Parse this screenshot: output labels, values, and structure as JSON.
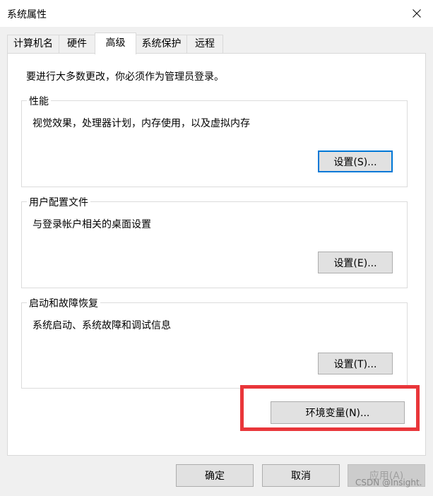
{
  "window": {
    "title": "系统属性"
  },
  "tabs": [
    {
      "label": "计算机名",
      "active": false
    },
    {
      "label": "硬件",
      "active": false
    },
    {
      "label": "高级",
      "active": true
    },
    {
      "label": "系统保护",
      "active": false
    },
    {
      "label": "远程",
      "active": false
    }
  ],
  "admin_notice": "要进行大多数更改，你必须作为管理员登录。",
  "groups": {
    "performance": {
      "title": "性能",
      "description": "视觉效果，处理器计划，内存使用，以及虚拟内存",
      "button": "设置(S)..."
    },
    "user_profiles": {
      "title": "用户配置文件",
      "description": "与登录帐户相关的桌面设置",
      "button": "设置(E)..."
    },
    "startup_recovery": {
      "title": "启动和故障恢复",
      "description": "系统启动、系统故障和调试信息",
      "button": "设置(T)..."
    }
  },
  "env_button": "环境变量(N)...",
  "footer": {
    "ok": "确定",
    "cancel": "取消",
    "apply": "应用(A)"
  },
  "watermark": "CSDN @Insight.",
  "colors": {
    "highlight": "#e9363a",
    "focus": "#0078d7"
  },
  "icons": {
    "close": "close-icon"
  }
}
